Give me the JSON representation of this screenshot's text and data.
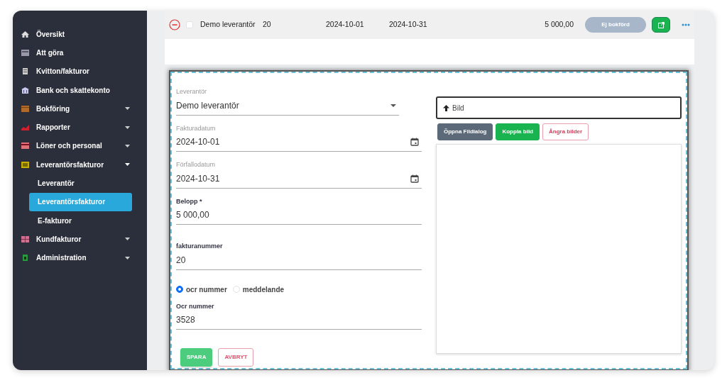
{
  "sidebar": {
    "items": [
      {
        "label": "Översikt",
        "kind": "link"
      },
      {
        "label": "Att göra",
        "kind": "link"
      },
      {
        "label": "Kvitton/fakturor",
        "kind": "link"
      },
      {
        "label": "Bank och skattekonto",
        "kind": "link"
      },
      {
        "label": "Bokföring",
        "kind": "group",
        "expanded": false
      },
      {
        "label": "Rapporter",
        "kind": "group",
        "expanded": false
      },
      {
        "label": "Löner och personal",
        "kind": "group",
        "expanded": false
      },
      {
        "label": "Leverantörsfakturor",
        "kind": "group",
        "expanded": true,
        "children": [
          {
            "label": "Leverantör",
            "selected": false
          },
          {
            "label": "Leverantörsfakturor",
            "selected": true
          },
          {
            "label": "E-fakturor",
            "selected": false
          }
        ]
      },
      {
        "label": "Kundfakturor",
        "kind": "group",
        "expanded": false
      },
      {
        "label": "Administration",
        "kind": "group",
        "expanded": false
      }
    ]
  },
  "invoice_row": {
    "expanded": true,
    "checked": false,
    "cells": [
      "Demo leverantör",
      "20",
      "2024-10-01",
      "2024-10-31",
      "5 000,00"
    ],
    "status": "Ej bokförd"
  },
  "form": {
    "fields": [
      {
        "kind": "select",
        "label": "Leverantör",
        "value": "Demo leverantör"
      },
      {
        "kind": "date",
        "label": "Fakturadatum",
        "value": "2024-10-01"
      },
      {
        "kind": "date",
        "label": "Förfallodatum",
        "value": "2024-10-31"
      },
      {
        "kind": "text",
        "label": "Belopp *",
        "value": "5 000,00"
      },
      {
        "kind": "text",
        "label": "fakturanummer",
        "value": "20"
      },
      {
        "kind": "radio",
        "options": [
          {
            "label": "ocr nummer",
            "selected": true
          },
          {
            "label": "meddelande",
            "selected": false
          }
        ]
      },
      {
        "kind": "text",
        "label": "Ocr nummer",
        "value": "3528"
      }
    ],
    "buttons": [
      {
        "label": "SPARA",
        "kind": "primary"
      },
      {
        "label": "AVBRYT",
        "kind": "outline"
      }
    ]
  },
  "image_panel": {
    "upload_label": "Bild",
    "buttons": [
      {
        "label": "Öppna Fildialog",
        "kind": "secondary"
      },
      {
        "label": "Koppla bild",
        "kind": "success"
      },
      {
        "label": "Ångra bilder",
        "kind": "outline"
      }
    ]
  }
}
